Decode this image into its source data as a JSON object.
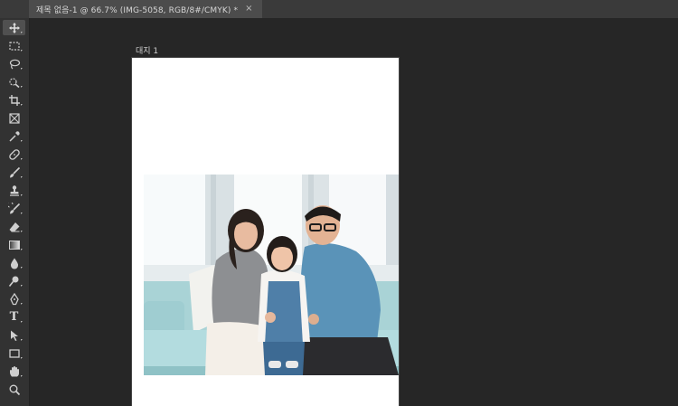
{
  "document_tab": {
    "title": "제목 없음-1 @ 66.7% (IMG-5058, RGB/8#/CMYK) *",
    "close_glyph": "×"
  },
  "artboard": {
    "label": "대지 1"
  },
  "toolbar": {
    "tools": [
      {
        "name": "move-icon",
        "active": true
      },
      {
        "name": "marquee-icon"
      },
      {
        "name": "lasso-icon"
      },
      {
        "name": "quick-selection-icon"
      },
      {
        "name": "crop-icon"
      },
      {
        "name": "frame-icon"
      },
      {
        "name": "eyedropper-icon"
      },
      {
        "name": "healing-brush-icon"
      },
      {
        "name": "brush-icon"
      },
      {
        "name": "clone-stamp-icon"
      },
      {
        "name": "history-brush-icon"
      },
      {
        "name": "eraser-icon"
      },
      {
        "name": "gradient-icon"
      },
      {
        "name": "blur-icon"
      },
      {
        "name": "dodge-icon"
      },
      {
        "name": "pen-icon"
      },
      {
        "name": "type-icon",
        "label": "T"
      },
      {
        "name": "path-selection-icon"
      },
      {
        "name": "rectangle-icon"
      },
      {
        "name": "hand-icon"
      },
      {
        "name": "zoom-icon"
      }
    ]
  },
  "colors": {
    "workspace": "#262626",
    "toolbar": "#323232",
    "tabbar": "#3a3a3a",
    "active_tab": "#4c4c4c"
  }
}
